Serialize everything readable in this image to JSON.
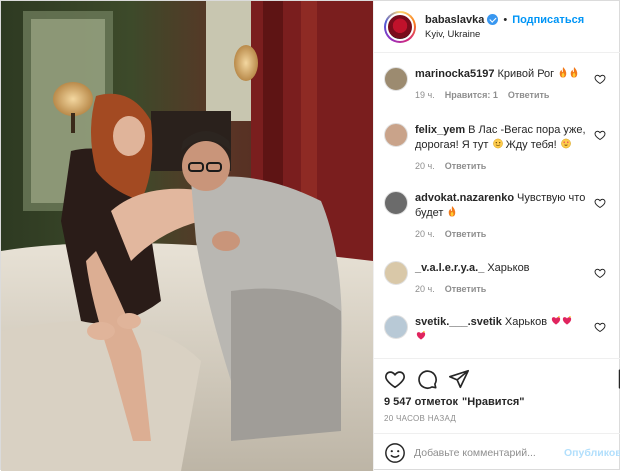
{
  "header": {
    "username": "babaslavka",
    "dot": "•",
    "follow_label": "Подписаться",
    "location": "Kyiv, Ukraine"
  },
  "comments": [
    {
      "user": "marinocka5197",
      "text": "Кривой Рог",
      "emoji": [
        "fire-emoji",
        "fire-emoji"
      ],
      "time": "19 ч.",
      "likes": "Нравится: 1",
      "reply": "Ответить",
      "avatar_color": "#9c8b70"
    },
    {
      "user": "felix_yem",
      "text": "В Лас -Вегас пора уже, дорогая! Я тут",
      "text_after": "Жду тебя!",
      "time": "20 ч.",
      "reply": "Ответить",
      "avatar_color": "#c9a38a"
    },
    {
      "user": "advokat.nazarenko",
      "text": "Чувствую что будет",
      "time": "20 ч.",
      "reply": "Ответить",
      "avatar_color": "#6b6b6b"
    },
    {
      "user": "_v.a.l.e.r.y.a._",
      "text": "Харьков",
      "time": "20 ч.",
      "reply": "Ответить",
      "avatar_color": "#d9c8a8"
    },
    {
      "user": "svetik.___.svetik",
      "text": "Харьков",
      "time": "",
      "avatar_color": "#b8c9d6"
    }
  ],
  "footer": {
    "likes_count": "9 547 отметок",
    "likes_word": "\"Нравится\"",
    "time_ago": "20 ЧАСОВ НАЗАД",
    "comment_placeholder": "Добавьте комментарий...",
    "publish_label": "Опубликовать"
  },
  "colors": {
    "accent": "#0095f6",
    "publish_disabled": "#b2dffc",
    "verified": "#3897f0"
  }
}
